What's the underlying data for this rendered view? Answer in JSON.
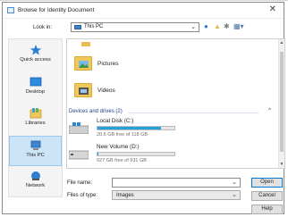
{
  "window": {
    "title": "Browse for Identity Document",
    "close_glyph": "✕"
  },
  "toolbar": {
    "lookin_label": "Look in:",
    "lookin_value": "This PC",
    "icons": [
      "back-icon",
      "up-folder-icon",
      "new-folder-icon",
      "view-menu-icon"
    ]
  },
  "places": [
    {
      "label": "Quick access",
      "icon": "star-icon",
      "active": false
    },
    {
      "label": "Desktop",
      "icon": "desktop-icon",
      "active": false
    },
    {
      "label": "Libraries",
      "icon": "library-icon",
      "active": false
    },
    {
      "label": "This PC",
      "icon": "pc-icon",
      "active": true
    },
    {
      "label": "Network",
      "icon": "network-icon",
      "active": false
    }
  ],
  "folders": [
    {
      "name": "Pictures",
      "icon": "pictures-folder-icon"
    },
    {
      "name": "Videos",
      "icon": "videos-folder-icon"
    }
  ],
  "drives_group": {
    "label": "Devices and drives (2)"
  },
  "drives": [
    {
      "name": "Local Disk (C:)",
      "free_text": "20.6 GB free of 118 GB",
      "used_fraction": 0.83,
      "icon": "windows-drive-icon"
    },
    {
      "name": "New Volume (D:)",
      "free_text": "927 GB free of 931 GB",
      "used_fraction": 0.004,
      "icon": "hard-drive-icon"
    }
  ],
  "form": {
    "filename_label": "File name:",
    "filename_value": "",
    "filetype_label": "Files of type:",
    "filetype_value": "Images"
  },
  "buttons": {
    "open": "Open",
    "cancel": "Cancel",
    "help": "Help"
  },
  "colors": {
    "accent": "#0078d7",
    "selection": "#cce4f7",
    "drive_bar": "#26a0da",
    "folder": "#f0c75a"
  }
}
